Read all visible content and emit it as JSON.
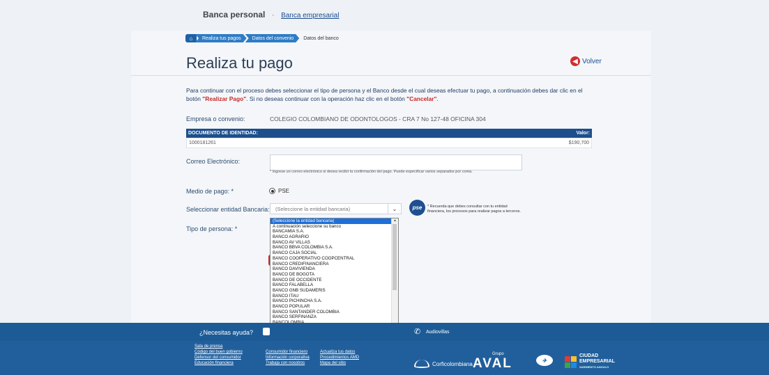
{
  "topnav": {
    "personal": "Banca personal",
    "sep": "·",
    "empresarial": "Banca empresarial"
  },
  "breadcrumb": {
    "home_icon": "home-icon",
    "items": [
      "Realiza tus pagos",
      "Datos del convenio"
    ],
    "current": "Datos del banco"
  },
  "page": {
    "title": "Realiza tu pago",
    "back_label": "Volver"
  },
  "intro": {
    "part1": "Para continuar con el proceso debes seleccionar el tipo de persona y el Banco desde el cual deseas efectuar tu pago, a continuación debes dar clic en el botón ",
    "realizar": "\"Realizar Pago\"",
    "part2": ". Si no deseas continuar con la operación haz clic en el botón ",
    "cancelar": "\"Cancelar\"",
    "part3": "."
  },
  "empresa": {
    "label": "Empresa o convenio:",
    "value": "COLEGIO COLOMBIANO DE ODONTOLOGOS - CRA 7 No 127-48 OFICINA 304"
  },
  "doc_table": {
    "col1": "DOCUMENTO DE IDENTIDAD:",
    "col2": "Valor:",
    "doc": "1000181261",
    "valor": "$190,700"
  },
  "email": {
    "label": "Correo Electrónico:",
    "value": "",
    "hint": "* Ingrese un correo electrónico si desea recibir la confirmación del pago. Puede especificar varios separados por coma."
  },
  "medio": {
    "label": "Medio de pago: *",
    "option": "PSE"
  },
  "entidad": {
    "label": "Seleccionar entidad Bancaria: *",
    "selected": "(Seleccione la entidad bancaria)",
    "note1": "* Recuerda que debes consultar con tu entidad",
    "note2": "financiera, los procesos para realizar pagos a terceros.",
    "pse_logo": "pse"
  },
  "tipo": {
    "label": "Tipo de persona: *"
  },
  "dropdown_options": [
    "(Seleccione la entidad bancaria)",
    "A continuación seleccione su banco",
    "BANCAMIA S.A.",
    "BANCO AGRARIO",
    "BANCO AV VILLAS",
    "BANCO BBVA COLOMBIA S.A.",
    "BANCO CAJA SOCIAL",
    "BANCO COOPERATIVO COOPCENTRAL",
    "BANCO CREDIFINANCIERA",
    "BANCO DAVIVIENDA",
    "BANCO DE BOGOTA",
    "BANCO DE OCCIDENTE",
    "BANCO FALABELLA",
    "BANCO GNB SUDAMERIS",
    "BANCO ITAU",
    "BANCO PICHINCHA S.A.",
    "BANCO POPULAR",
    "BANCO SANTANDER COLOMBIA",
    "BANCO SERFINANZA",
    "BANCOLOMBIA"
  ],
  "help": {
    "label": "¿Necesitas ayuda?",
    "audio": "Audiovillas"
  },
  "footer": {
    "col1": [
      "Sala de prensa",
      "Código del buen gobierno",
      "Defensor del consumidor",
      "Educación financiera"
    ],
    "col2": [
      "Consumidor financiero",
      "Información corporativa",
      "Trabaja con nosotros"
    ],
    "col3": [
      "Actualiza tus datos",
      "Procedimientos AMD",
      "Mapa del sitio"
    ],
    "corfi": "Corficolombiana",
    "grupo": "Grupo",
    "aval": "AVAL",
    "ciudad1": "CIUDAD",
    "ciudad2": "EMPRESARIAL",
    "ciudad3": "SARMIENTO ANGULO"
  },
  "colors": {
    "brand_blue": "#1d4f8c",
    "accent_red": "#c62828",
    "footer_blue": "#215f9c"
  }
}
